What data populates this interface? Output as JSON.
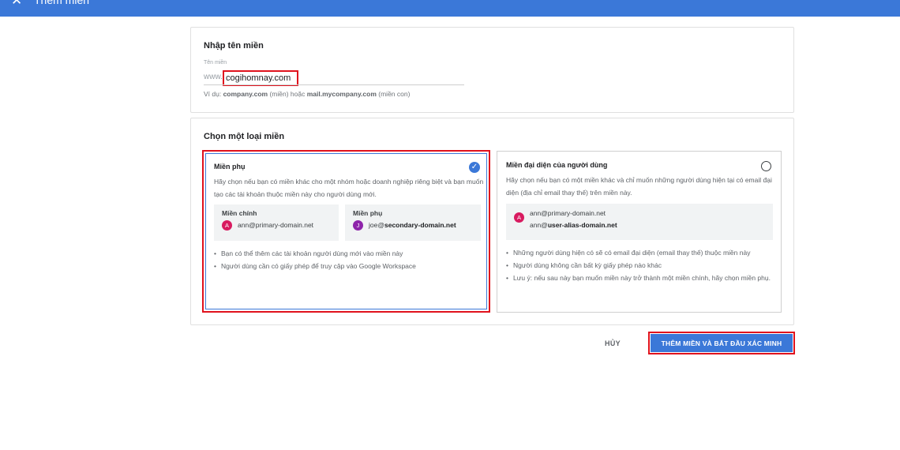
{
  "header": {
    "title": "Thêm miền",
    "close_icon": "close-icon"
  },
  "domain_card": {
    "title": "Nhập tên miền",
    "field_label": "Tên miền",
    "prefix": "www.",
    "value": "cogihomnay.com",
    "hint_prefix": "Ví dụ: ",
    "hint_example1": "company.com",
    "hint_middle": " (miền) hoặc ",
    "hint_example2": "mail.mycompany.com",
    "hint_suffix": " (miền con)"
  },
  "type_card": {
    "title": "Chọn một loại miền",
    "options": [
      {
        "title": "Miền phụ",
        "selected": true,
        "description": "Hãy chọn nếu bạn có miền khác cho một nhóm hoặc doanh nghiệp riêng biệt và bạn muốn tạo các tài khoản thuộc miền này cho người dùng mới.",
        "examples": [
          {
            "label": "Miền chính",
            "avatar": "A",
            "avatar_color": "#d81b60",
            "email": "ann@primary-domain.net"
          },
          {
            "label": "Miền phụ",
            "avatar": "J",
            "avatar_color": "#8e24aa",
            "email_user": "joe@",
            "email_domain": "secondary-domain.net"
          }
        ],
        "bullets": [
          "Bạn có thể thêm các tài khoản người dùng mới vào miền này",
          "Người dùng cần có giấy phép để truy cập vào Google Workspace"
        ]
      },
      {
        "title": "Miền đại diện của người dùng",
        "selected": false,
        "description": "Hãy chọn nếu bạn có một miền khác và chỉ muốn những người dùng hiện tại có email đại diện (địa chỉ email thay thế) trên miền này.",
        "examples": [
          {
            "avatar": "A",
            "avatar_color": "#d81b60",
            "email": "ann@primary-domain.net",
            "email2_user": "ann@",
            "email2_domain": "user-alias-domain.net"
          }
        ],
        "bullets": [
          "Những người dùng hiện có sẽ có email đại diện (email thay thế) thuộc miền này",
          "Người dùng không cần bất kỳ giấy phép nào khác",
          "Lưu ý: nếu sau này bạn muốn miền này trở thành một miền chính, hãy chọn miền phụ."
        ]
      }
    ]
  },
  "actions": {
    "cancel": "HỦY",
    "submit": "THÊM MIỀN VÀ BẮT ĐẦU XÁC MINH"
  },
  "colors": {
    "primary": "#3b78d8",
    "highlight": "#e0121d"
  }
}
